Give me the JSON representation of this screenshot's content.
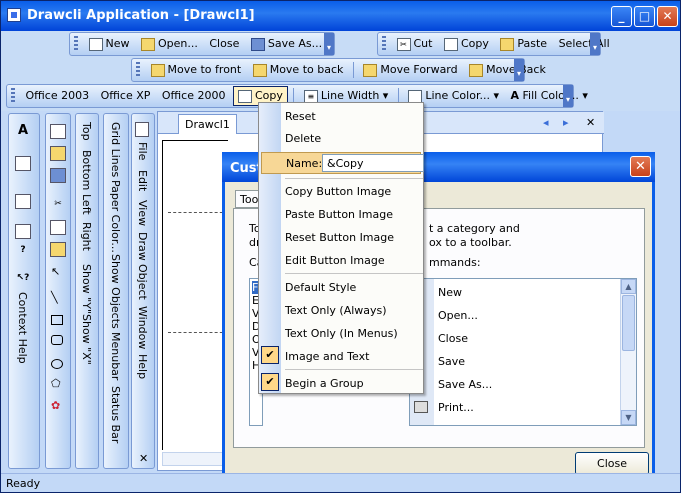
{
  "window": {
    "title": "Drawcli Application - [Drawcl1]",
    "min": "_",
    "max": "□",
    "close": "✕"
  },
  "toolbars": {
    "standard": [
      "New",
      "Open...",
      "Close",
      "Save As..."
    ],
    "edit": [
      "Cut",
      "Copy",
      "Paste",
      "Select All"
    ],
    "arrange": [
      "Move to front",
      "Move to back",
      "Move Forward",
      "Move Back"
    ],
    "style": {
      "office2003": "Office 2003",
      "officexp": "Office XP",
      "office2000": "Office 2000",
      "copy": "Copy",
      "line_width": "Line Width",
      "line_color": "Line Color...",
      "fill_color": "Fill Color..."
    }
  },
  "vbar_text": {
    "context_help": "Context Help",
    "top": "Top",
    "bottom": "Bottom",
    "left": "Left",
    "right": "Right",
    "show_y": "Show \"Y\"",
    "show_x": "Show \"X\"",
    "grid_lines": "Grid Lines",
    "paper_color": "Paper Color...",
    "show_objects": "Show Objects",
    "menubar": "Menubar",
    "status_bar": "Status Bar",
    "file": "File",
    "edit": "Edit",
    "view": "View",
    "draw": "Draw",
    "object": "Object",
    "window": "Window",
    "help": "Help"
  },
  "doc": {
    "tab": "Drawcl1"
  },
  "dialog": {
    "title": "Cust",
    "tab": "Too",
    "hint1": "To",
    "hint2": "dr",
    "hint_r1": "t a category and",
    "hint_r2": "ox to a toolbar.",
    "cat_label": "Ca",
    "cmd_label": "mmands:",
    "categories": [
      "F",
      "E",
      "V",
      "D",
      "O",
      "V",
      "H"
    ],
    "commands": [
      "New",
      "Open...",
      "Close",
      "Save",
      "Save As...",
      "Print..."
    ],
    "close": "Close"
  },
  "menu": {
    "reset": "Reset",
    "delete": "Delete",
    "name_label": "Name:",
    "name_value": "&Copy",
    "copy_image": "Copy Button Image",
    "paste_image": "Paste Button Image",
    "reset_image": "Reset Button Image",
    "edit_image": "Edit Button Image",
    "default_style": "Default Style",
    "text_only_always": "Text Only (Always)",
    "text_only_menus": "Text Only (In Menus)",
    "image_and_text": "Image and Text",
    "begin_group": "Begin a Group"
  },
  "status": {
    "text": "Ready"
  }
}
